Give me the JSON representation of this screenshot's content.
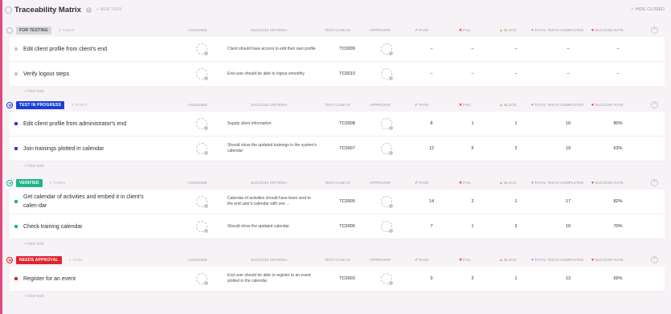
{
  "header": {
    "title": "Traceability Matrix",
    "info_glyph": "i",
    "new_task": "+ NEW TASK",
    "hide_closed": "✓ HIDE CLOSED"
  },
  "columns": {
    "assignee": "ASSIGNEE",
    "criteria": "SUCCESS CRITERIA",
    "tcid": "TEST CASE ID",
    "approver": "APPROVER",
    "pass": "PASS",
    "fail": "FAIL",
    "block": "BLOCK",
    "total": "TOTAL TESTS COMPLETED",
    "rate": "SUCCESS RATE"
  },
  "icons": {
    "pass": "✓",
    "fail": "✕",
    "block": "▲",
    "total": "+",
    "rate": "♥",
    "plus": "+"
  },
  "new_task_row": "+ New task",
  "groups": [
    {
      "status": "FOR TESTING",
      "count": "2 TASKS",
      "color": "#d8d8dc",
      "text_color": "#4a4e55",
      "dot_color": "#c6c6cc",
      "tasks": [
        {
          "name": "Edit client profile from client's end",
          "criteria": "Client should have access to edit their own profile",
          "tcid": "TC0009",
          "pass": "–",
          "fail": "–",
          "block": "–",
          "total": "–",
          "rate": "–"
        },
        {
          "name": "Verify logout steps",
          "criteria": "End user should be able to logout smoothly",
          "tcid": "TC0010",
          "pass": "–",
          "fail": "–",
          "block": "–",
          "total": "–",
          "rate": "–"
        }
      ]
    },
    {
      "status": "TEST IN PROGRESS",
      "count": "2 TASKS",
      "color": "#1a3ed6",
      "text_color": "#ffffff",
      "dot_color": "#1a3ed6",
      "tasks": [
        {
          "name": "Edit client profile from administrator's end",
          "criteria": "Supply client information",
          "tcid": "TC0008",
          "pass": "8",
          "fail": "1",
          "block": "1",
          "total": "10",
          "rate": "80%"
        },
        {
          "name": "Join trainings plotted in calendar",
          "criteria": "Should show the updated trainings in the system's calendar",
          "tcid": "TC0007",
          "pass": "12",
          "fail": "5",
          "block": "2",
          "total": "19",
          "rate": "63%"
        }
      ]
    },
    {
      "status": "VERIFIED",
      "count": "2 TASKS",
      "color": "#1fb58a",
      "text_color": "#ffffff",
      "dot_color": "#1fb58a",
      "tasks": [
        {
          "name": "Get calendar of activities and embed it in client's calen-dar",
          "criteria": "Calendar of activities should have been sent to the end user's calendar with one ...",
          "tcid": "TC0005",
          "pass": "14",
          "fail": "2",
          "block": "1",
          "total": "17",
          "rate": "82%"
        },
        {
          "name": "Check training calendar",
          "criteria": "Should show the updated calendar",
          "tcid": "TC0006",
          "pass": "7",
          "fail": "1",
          "block": "2",
          "total": "10",
          "rate": "70%"
        }
      ]
    },
    {
      "status": "NEEDS APPROVAL",
      "count": "1 TASK",
      "color": "#e0232e",
      "text_color": "#ffffff",
      "dot_color": "#e0232e",
      "tasks": [
        {
          "name": "Register for an event",
          "criteria": "End user should be able to register to an event plotted in the calendar",
          "tcid": "TC0003",
          "pass": "9",
          "fail": "3",
          "block": "1",
          "total": "13",
          "rate": "69%"
        }
      ]
    }
  ],
  "colors": {
    "pass": "#1fb58a",
    "fail": "#e0232e",
    "block": "#f2a21c",
    "total": "#7b68ee",
    "rate": "#e0232e"
  }
}
